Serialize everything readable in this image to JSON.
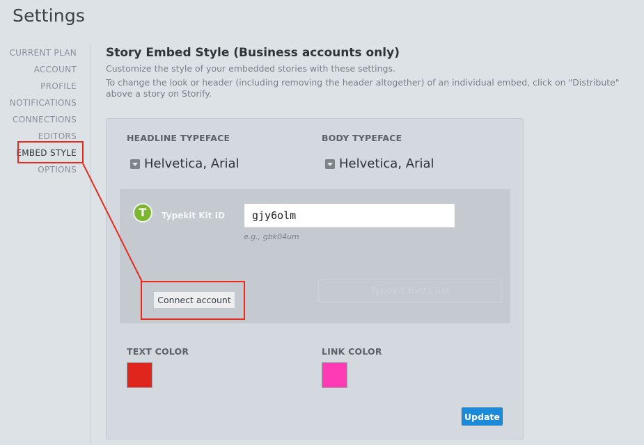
{
  "page": {
    "title": "Settings"
  },
  "sidebar": {
    "items": [
      {
        "label": "CURRENT PLAN"
      },
      {
        "label": "ACCOUNT"
      },
      {
        "label": "PROFILE"
      },
      {
        "label": "NOTIFICATIONS"
      },
      {
        "label": "CONNECTIONS"
      },
      {
        "label": "EDITORS"
      },
      {
        "label": "EMBED STYLE",
        "active": true
      },
      {
        "label": "OPTIONS"
      }
    ]
  },
  "section": {
    "title": "Story Embed Style (Business accounts only)",
    "description": "Customize the style of your embedded stories with these settings.",
    "note": "To change the look or header (including removing the header altogether) of an individual embed, click on \"Distribute\" above a story on Storify."
  },
  "typeface": {
    "headline_label": "HEADLINE TYPEFACE",
    "headline_value": "Helvetica, Arial",
    "body_label": "BODY TYPEFACE",
    "body_value": "Helvetica, Arial"
  },
  "typekit": {
    "logo_glyph": "T",
    "label": "Typekit Kit ID",
    "value": "gjy6olm",
    "hint": "e.g., gbk04um",
    "connect_label": "Connect account",
    "ghost_label": "Typekit fonts list"
  },
  "colors": {
    "text_label": "TEXT COLOR",
    "text_value": "#e0261c",
    "link_label": "LINK COLOR",
    "link_value": "#ff3ab4"
  },
  "actions": {
    "update_label": "Update"
  },
  "annotation": {
    "color": "#e8291c"
  }
}
